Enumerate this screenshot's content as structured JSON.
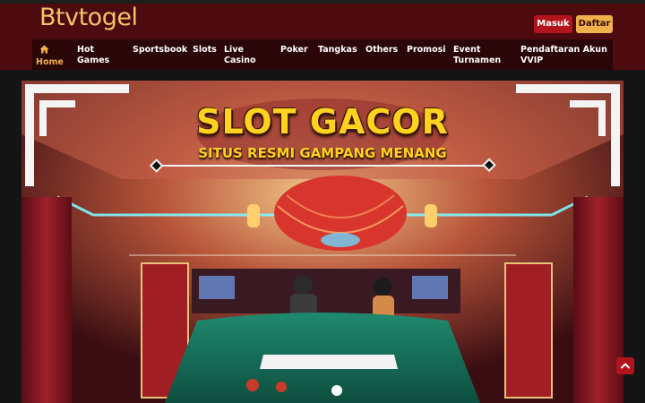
{
  "header": {
    "logo_text": "Btvtogel",
    "login_label": "Masuk",
    "register_label": "Daftar"
  },
  "nav": {
    "items": [
      {
        "label": "Home",
        "icon": "home-icon",
        "active": true
      },
      {
        "label": "Hot Games"
      },
      {
        "label": "Sportsbook"
      },
      {
        "label": "Slots"
      },
      {
        "label": "Live Casino"
      },
      {
        "label": "Poker"
      },
      {
        "label": "Tangkas"
      },
      {
        "label": "Others"
      },
      {
        "label": "Promosi"
      },
      {
        "label": "Event Turnamen"
      },
      {
        "label": "Pendaftaran Akun VVIP"
      }
    ]
  },
  "banner": {
    "headline": "SLOT GACOR",
    "subheadline": "SITUS RESMI GAMPANG MENANG"
  },
  "scroll_top": {
    "icon": "chevron-up-icon"
  },
  "colors": {
    "header_bg": "#4d0a0f",
    "nav_bg": "#2b0608",
    "accent_gold": "#f0b14a",
    "accent_red": "#b3141c",
    "page_bg": "#141414"
  }
}
